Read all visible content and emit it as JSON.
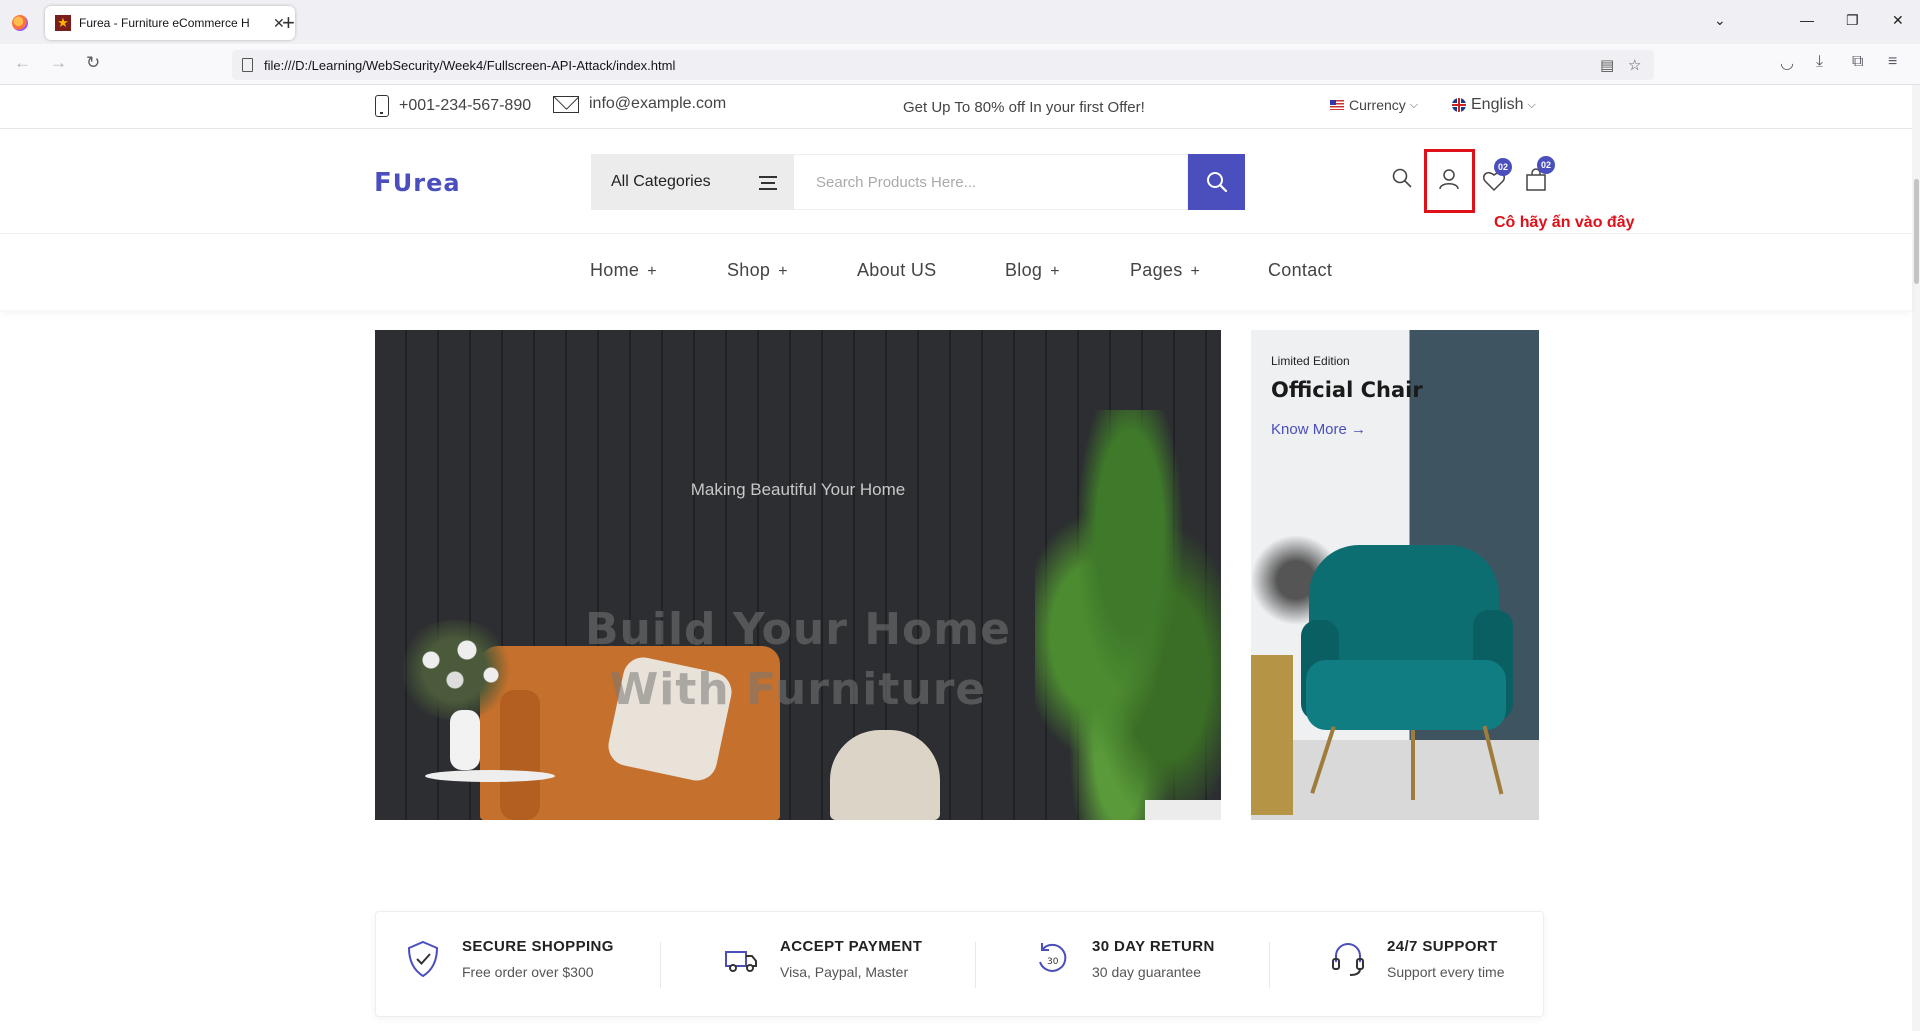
{
  "browser": {
    "tab_title": "Furea - Furniture eCommerce H",
    "tab_close": "✕",
    "new_tab": "+",
    "url": "file:///D:/Learning/WebSecurity/Week4/Fullscreen-API-Attack/index.html"
  },
  "topbar": {
    "phone": "+001-234-567-890",
    "email": "info@example.com",
    "promo": "Get Up To 80% off In your first Offer!",
    "currency": "Currency",
    "language": "English"
  },
  "header": {
    "logo_f": "F",
    "logo_rest": "Urea",
    "category": "All Categories",
    "search_placeholder": "Search Products Here...",
    "wishlist_count": "02",
    "cart_count": "02",
    "annotation": "Cô hãy ấn vào đây",
    "annotation_color": "#e0101a",
    "accent_color": "#4a4fbd"
  },
  "nav": {
    "items": [
      {
        "label": "Home",
        "plus": "+"
      },
      {
        "label": "Shop",
        "plus": "+"
      },
      {
        "label": "About US",
        "plus": ""
      },
      {
        "label": "Blog",
        "plus": "+"
      },
      {
        "label": "Pages",
        "plus": "+"
      },
      {
        "label": "Contact",
        "plus": ""
      }
    ]
  },
  "hero": {
    "subtitle": "Making Beautiful Your Home",
    "title_line1": "Build Your Home",
    "title_line2": "With Furniture"
  },
  "side_banner": {
    "label": "Limited Edition",
    "title": "Official Chair",
    "link": "Know More →"
  },
  "features": [
    {
      "icon": "shield-check-icon",
      "title": "SECURE SHOPPING",
      "subtitle": "Free order over $300"
    },
    {
      "icon": "truck-icon",
      "title": "ACCEPT PAYMENT",
      "subtitle": "Visa, Paypal, Master"
    },
    {
      "icon": "return-icon",
      "title": "30 DAY RETURN",
      "subtitle": "30 day guarantee"
    },
    {
      "icon": "headset-icon",
      "title": "24/7 SUPPORT",
      "subtitle": "Support every time"
    }
  ]
}
